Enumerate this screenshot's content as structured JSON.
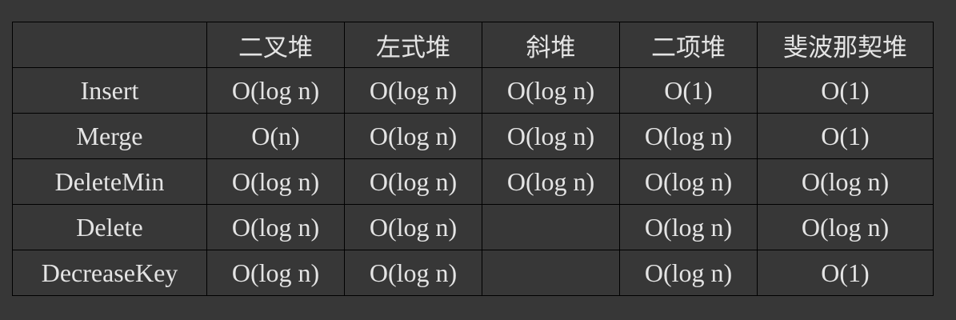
{
  "table": {
    "headers": [
      "",
      "二叉堆",
      "左式堆",
      "斜堆",
      "二项堆",
      "斐波那契堆"
    ],
    "rows": [
      {
        "op": "Insert",
        "cells": [
          "O(log n)",
          "O(log n)",
          "O(log n)",
          "O(1)",
          "O(1)"
        ]
      },
      {
        "op": "Merge",
        "cells": [
          "O(n)",
          "O(log n)",
          "O(log n)",
          "O(log n)",
          "O(1)"
        ]
      },
      {
        "op": "DeleteMin",
        "cells": [
          "O(log n)",
          "O(log n)",
          "O(log n)",
          "O(log n)",
          "O(log n)"
        ]
      },
      {
        "op": "Delete",
        "cells": [
          "O(log n)",
          "O(log n)",
          "",
          "O(log n)",
          "O(log n)"
        ]
      },
      {
        "op": "DecreaseKey",
        "cells": [
          "O(log n)",
          "O(log n)",
          "",
          "O(log n)",
          "O(1)"
        ]
      }
    ]
  },
  "colors": {
    "background": "#373737",
    "text": "#e4e4e4",
    "border": "#000000"
  }
}
